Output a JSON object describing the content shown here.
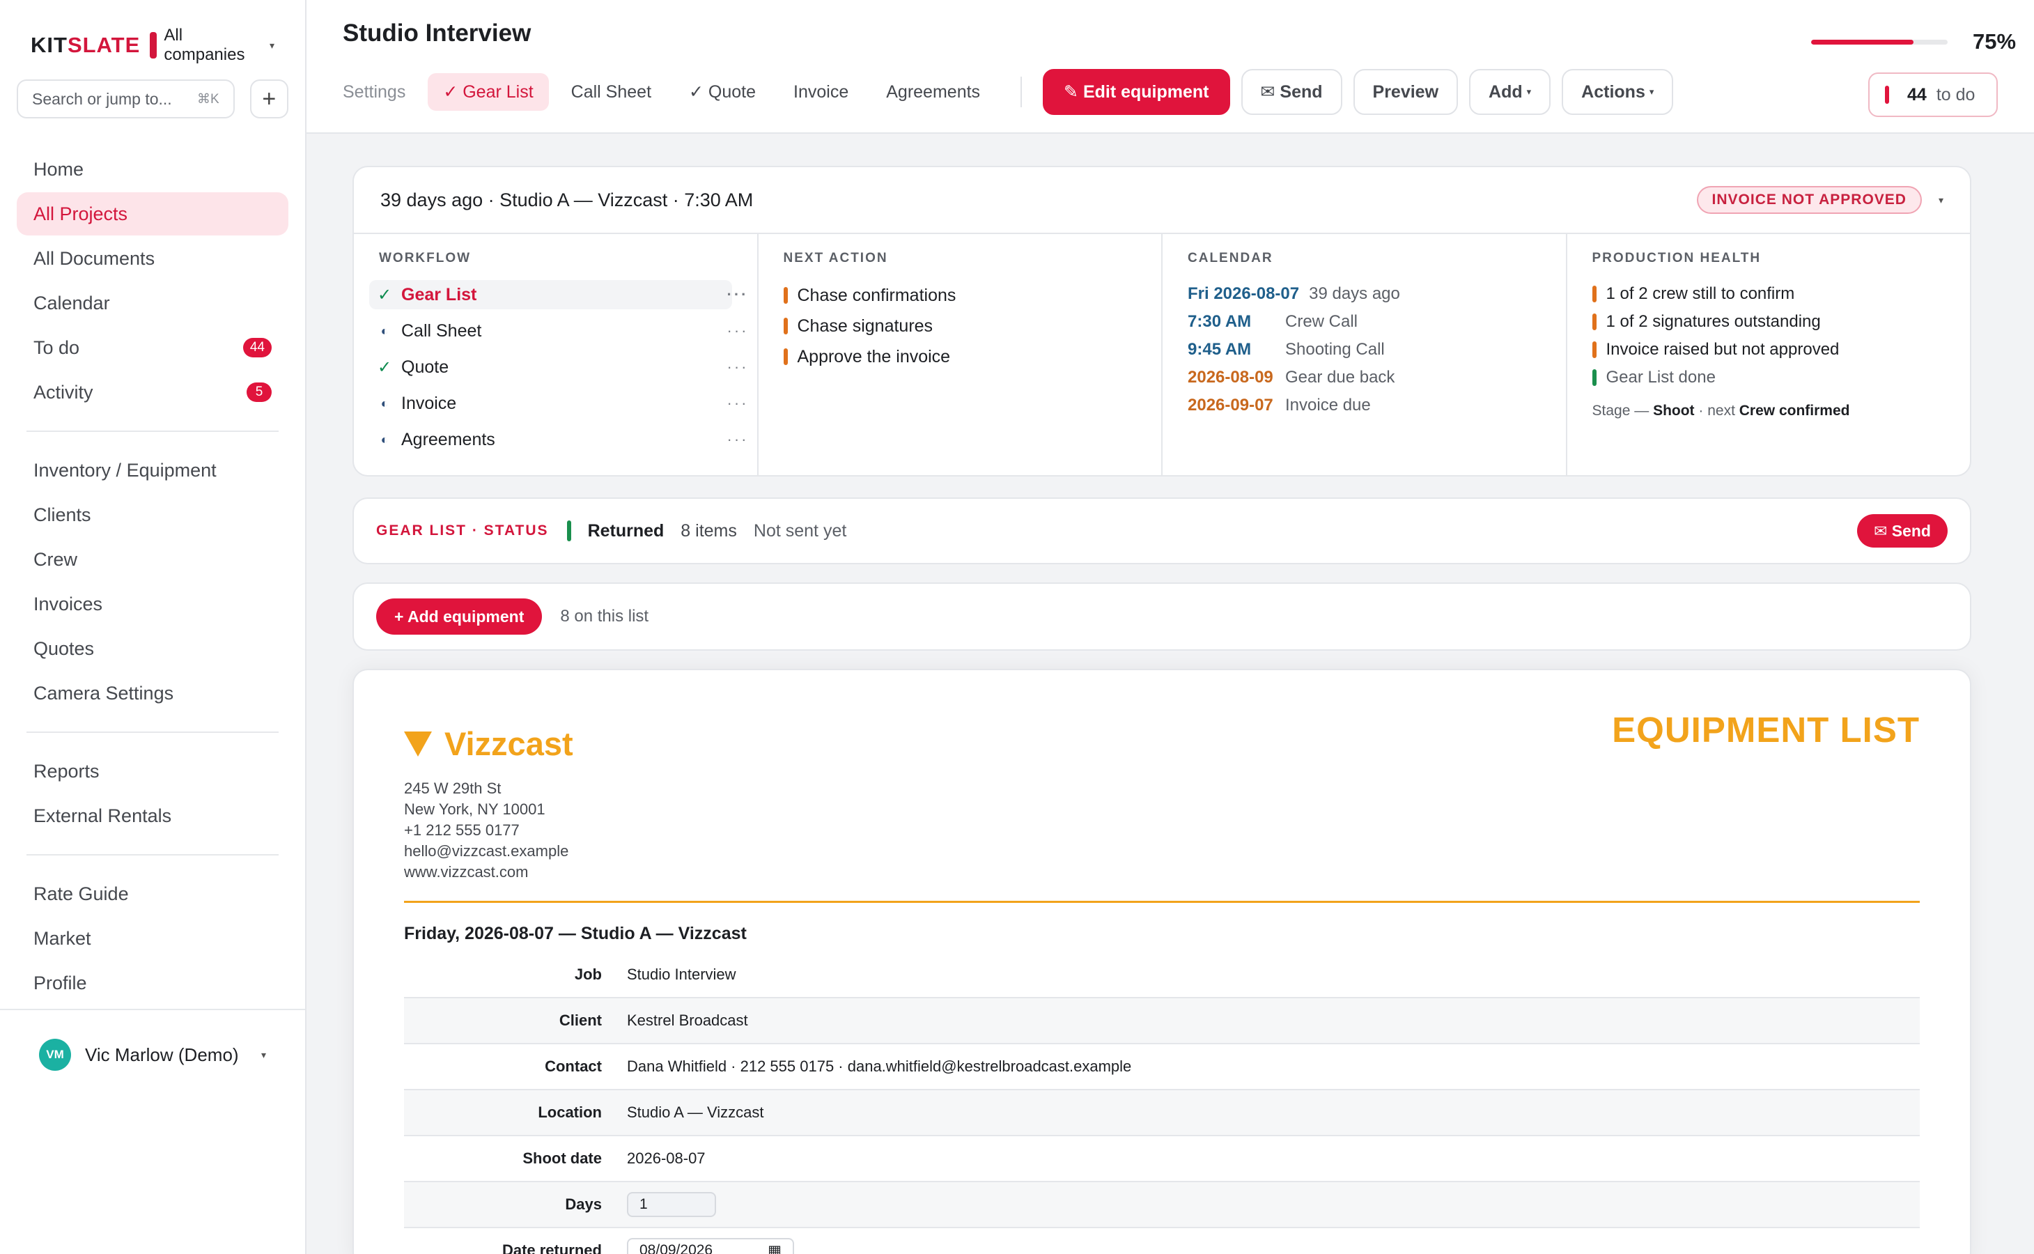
{
  "sidebar": {
    "brand": "KIT",
    "brand_accent": "SLATE",
    "company": "All companies",
    "search_placeholder": "Search or jump to...",
    "search_shortcut": "⌘K",
    "nav_group1": [
      {
        "label": "Home"
      },
      {
        "label": "All Projects",
        "active": true
      },
      {
        "label": "All Documents"
      },
      {
        "label": "Calendar"
      },
      {
        "label": "To do",
        "badge": "44"
      },
      {
        "label": "Activity",
        "badge": "5"
      }
    ],
    "nav_group2": [
      {
        "label": "Inventory / Equipment"
      },
      {
        "label": "Clients"
      },
      {
        "label": "Crew"
      },
      {
        "label": "Invoices"
      },
      {
        "label": "Quotes"
      },
      {
        "label": "Camera Settings"
      }
    ],
    "nav_group3": [
      {
        "label": "Reports"
      },
      {
        "label": "External Rentals"
      }
    ],
    "nav_group4": [
      {
        "label": "Rate Guide"
      },
      {
        "label": "Market"
      },
      {
        "label": "Profile"
      }
    ],
    "user": {
      "initials": "VM",
      "name": "Vic Marlow (Demo)"
    }
  },
  "header": {
    "title": "Studio Interview",
    "progress_percent": 75,
    "progress_label": "75%",
    "tabs": [
      {
        "label": "Settings",
        "muted": true
      },
      {
        "label": "✓ Gear List",
        "active": true
      },
      {
        "label": "Call Sheet"
      },
      {
        "label": "✓ Quote"
      },
      {
        "label": "Invoice"
      },
      {
        "label": "Agreements"
      }
    ],
    "buttons": {
      "edit": "✎ Edit equipment",
      "send": "✉ Send",
      "preview": "Preview",
      "add": "Add",
      "actions": "Actions"
    },
    "todo": {
      "count": "44",
      "label": "to do"
    }
  },
  "overview": {
    "summary": "39 days ago · Studio A — Vizzcast · 7:30 AM",
    "invoice_status": "INVOICE NOT APPROVED",
    "workflow": {
      "heading": "WORKFLOW",
      "items": [
        {
          "label": "Gear List",
          "state": "done",
          "active": true
        },
        {
          "label": "Call Sheet",
          "state": "partial"
        },
        {
          "label": "Quote",
          "state": "done"
        },
        {
          "label": "Invoice",
          "state": "partial"
        },
        {
          "label": "Agreements",
          "state": "partial"
        }
      ]
    },
    "next_action": {
      "heading": "NEXT ACTION",
      "items": [
        "Chase confirmations",
        "Chase signatures",
        "Approve the invoice"
      ]
    },
    "calendar": {
      "heading": "CALENDAR",
      "rows": [
        {
          "a": "Fri 2026-08-07",
          "b": "39 days ago",
          "color": "blue"
        },
        {
          "a": "7:30 AM",
          "b": "Crew Call",
          "color": "blue"
        },
        {
          "a": "9:45 AM",
          "b": "Shooting Call",
          "color": "blue"
        },
        {
          "a": "2026-08-09",
          "b": "Gear due back",
          "color": "orange"
        },
        {
          "a": "2026-09-07",
          "b": "Invoice due",
          "color": "orange"
        }
      ]
    },
    "health": {
      "heading": "PRODUCTION HEALTH",
      "items": [
        {
          "label": "1 of 2 crew still to confirm",
          "status": "orange"
        },
        {
          "label": "1 of 2 signatures outstanding",
          "status": "orange"
        },
        {
          "label": "Invoice raised but not approved",
          "status": "orange"
        },
        {
          "label": "Gear List done",
          "status": "green"
        }
      ],
      "stage_prefix": "Stage —",
      "stage": "Shoot",
      "next_prefix": "· next",
      "next": "Crew confirmed"
    }
  },
  "status_strip": {
    "label": "GEAR LIST · STATUS",
    "status": "Returned",
    "count": "8 items",
    "sent": "Not sent yet",
    "send_button": "✉ Send"
  },
  "add_strip": {
    "button": "+ Add equipment",
    "note": "8 on this list"
  },
  "document": {
    "brand": "Vizzcast",
    "title": "EQUIPMENT LIST",
    "address": [
      "245 W 29th St",
      "New York, NY 10001",
      "+1 212 555 0177",
      "hello@vizzcast.example",
      "www.vizzcast.com"
    ],
    "heading": "Friday, 2026-08-07 — Studio A — Vizzcast",
    "fields": [
      {
        "k": "Job",
        "v": "Studio Interview"
      },
      {
        "k": "Client",
        "v": "Kestrel Broadcast"
      },
      {
        "k": "Contact",
        "v": "Dana Whitfield · 212 555 0175 · dana.whitfield@kestrelbroadcast.example"
      },
      {
        "k": "Location",
        "v": "Studio A — Vizzcast"
      },
      {
        "k": "Shoot date",
        "v": "2026-08-07"
      }
    ],
    "days_label": "Days",
    "days_value": "1",
    "date_returned_label": "Date returned",
    "date_returned_value": "08/09/2026"
  },
  "colors": {
    "accent": "#e0143c",
    "doc_accent": "#f2a31b",
    "calendar_blue": "#1f5f8b",
    "calendar_orange": "#c8681d"
  }
}
